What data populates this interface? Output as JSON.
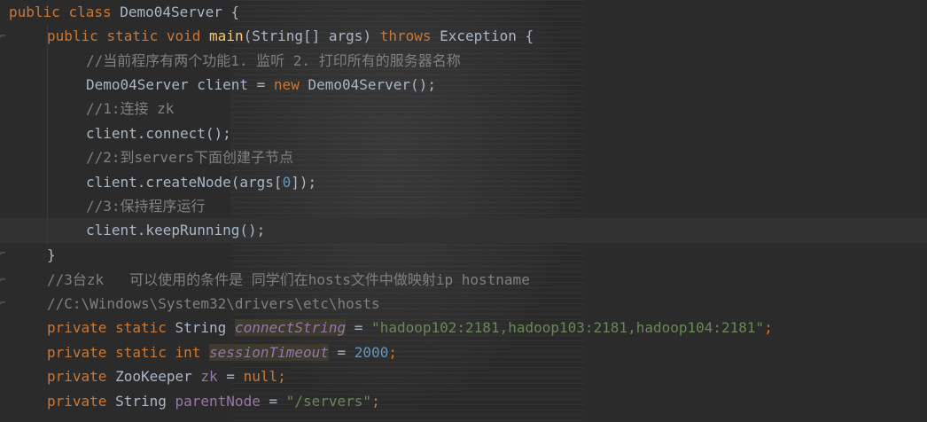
{
  "code": {
    "lines": [
      {
        "parts": [
          [
            "kw",
            "public "
          ],
          [
            "kw",
            "class "
          ],
          [
            "plain",
            "Demo04Server "
          ],
          [
            "brace",
            "{"
          ]
        ]
      },
      {
        "parts": [
          [
            "kw",
            "public "
          ],
          [
            "kw",
            "static "
          ],
          [
            "kw",
            "void "
          ],
          [
            "fn",
            "main"
          ],
          [
            "plain",
            "(String[] args) "
          ],
          [
            "kw",
            "throws "
          ],
          [
            "plain",
            "Exception "
          ],
          [
            "brace",
            "{"
          ]
        ]
      },
      {
        "parts": [
          [
            "cm",
            "//当前程序有两个功能1. 监听 2. 打印所有的服务器名称"
          ]
        ]
      },
      {
        "parts": [
          [
            "plain",
            "Demo04Server client = "
          ],
          [
            "kw",
            "new "
          ],
          [
            "plain",
            "Demo04Server();"
          ]
        ]
      },
      {
        "parts": [
          [
            "cm",
            "//1:连接 zk"
          ]
        ]
      },
      {
        "parts": [
          [
            "plain",
            "client.connect();"
          ]
        ]
      },
      {
        "parts": [
          [
            "cm",
            "//2:到servers下面创建子节点"
          ]
        ]
      },
      {
        "parts": [
          [
            "plain",
            "client.createNode(args["
          ],
          [
            "nm",
            "0"
          ],
          [
            "plain",
            "]);"
          ]
        ]
      },
      {
        "parts": [
          [
            "cm",
            "//3:保持程序运行"
          ]
        ]
      },
      {
        "parts": [
          [
            "plain",
            "client.keepRunning();"
          ]
        ]
      },
      {
        "parts": [
          [
            "brace",
            "}"
          ]
        ]
      },
      {
        "parts": [
          [
            "cm",
            "//3台zk   可以使用的条件是 同学们在hosts文件中做映射ip hostname"
          ]
        ]
      },
      {
        "parts": [
          [
            "cm",
            "//C:\\Windows\\System32\\drivers\\etc\\hosts"
          ]
        ]
      },
      {
        "parts": [
          [
            "kw",
            "private "
          ],
          [
            "kw",
            "static "
          ],
          [
            "plain",
            "String "
          ],
          [
            "fld-it",
            "connectString"
          ],
          [
            "plain",
            " = "
          ],
          [
            "st",
            "\"hadoop102:2181,hadoop103:2181,hadoop104:2181\""
          ],
          [
            "kw",
            ";"
          ]
        ]
      },
      {
        "parts": [
          [
            "kw",
            "private "
          ],
          [
            "kw",
            "static "
          ],
          [
            "kw",
            "int "
          ],
          [
            "fld-it",
            "sessionTimeout"
          ],
          [
            "plain",
            " = "
          ],
          [
            "nm",
            "2000"
          ],
          [
            "kw",
            ";"
          ]
        ]
      },
      {
        "parts": [
          [
            "kw",
            "private "
          ],
          [
            "plain",
            "ZooKeeper "
          ],
          [
            "fld",
            "zk"
          ],
          [
            "plain",
            " = "
          ],
          [
            "kw",
            "null"
          ],
          [
            "kw",
            ";"
          ]
        ]
      },
      {
        "parts": [
          [
            "kw",
            "private "
          ],
          [
            "plain",
            "String "
          ],
          [
            "fld",
            "parentNode"
          ],
          [
            "plain",
            " = "
          ],
          [
            "st",
            "\"/servers\""
          ],
          [
            "kw",
            ";"
          ]
        ]
      }
    ]
  }
}
